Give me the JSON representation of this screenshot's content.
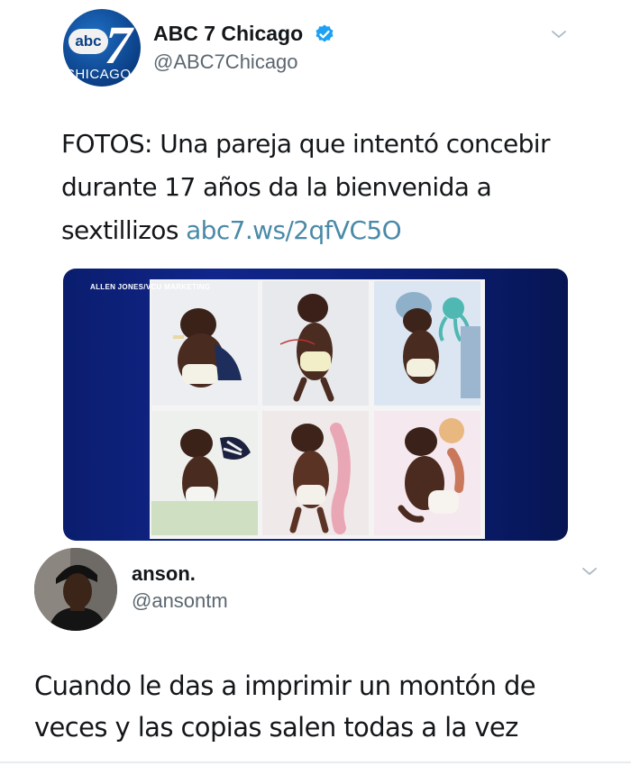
{
  "tweet1": {
    "author_name": "ABC 7 Chicago",
    "author_handle": "@ABC7Chicago",
    "avatar": {
      "badge_text": "abc",
      "number_text": "7",
      "city_text": "CHICAGO"
    },
    "verified_icon": "verified-badge-icon",
    "text_lines": [
      "FOTOS: Una pareja que intentó concebir",
      "durante 17 años da la bienvenida a"
    ],
    "text_line3": "sextillizos ",
    "link_text": "abc7.ws/2qfVC5O",
    "media": {
      "watermark": "ALLEN JONES/VCU MARKETING",
      "photo_count": 6
    },
    "colors": {
      "link": "#4a8aa8",
      "media_bg": "#0b1e74",
      "verified": "#1da1f2"
    }
  },
  "tweet2": {
    "author_name": "anson.",
    "author_handle": "@ansontm",
    "text_lines": [
      "Cuando le das a imprimir un montón de",
      "veces y las copias salen todas a la vez"
    ]
  },
  "icons": {
    "menu": "chevron-down-icon"
  }
}
